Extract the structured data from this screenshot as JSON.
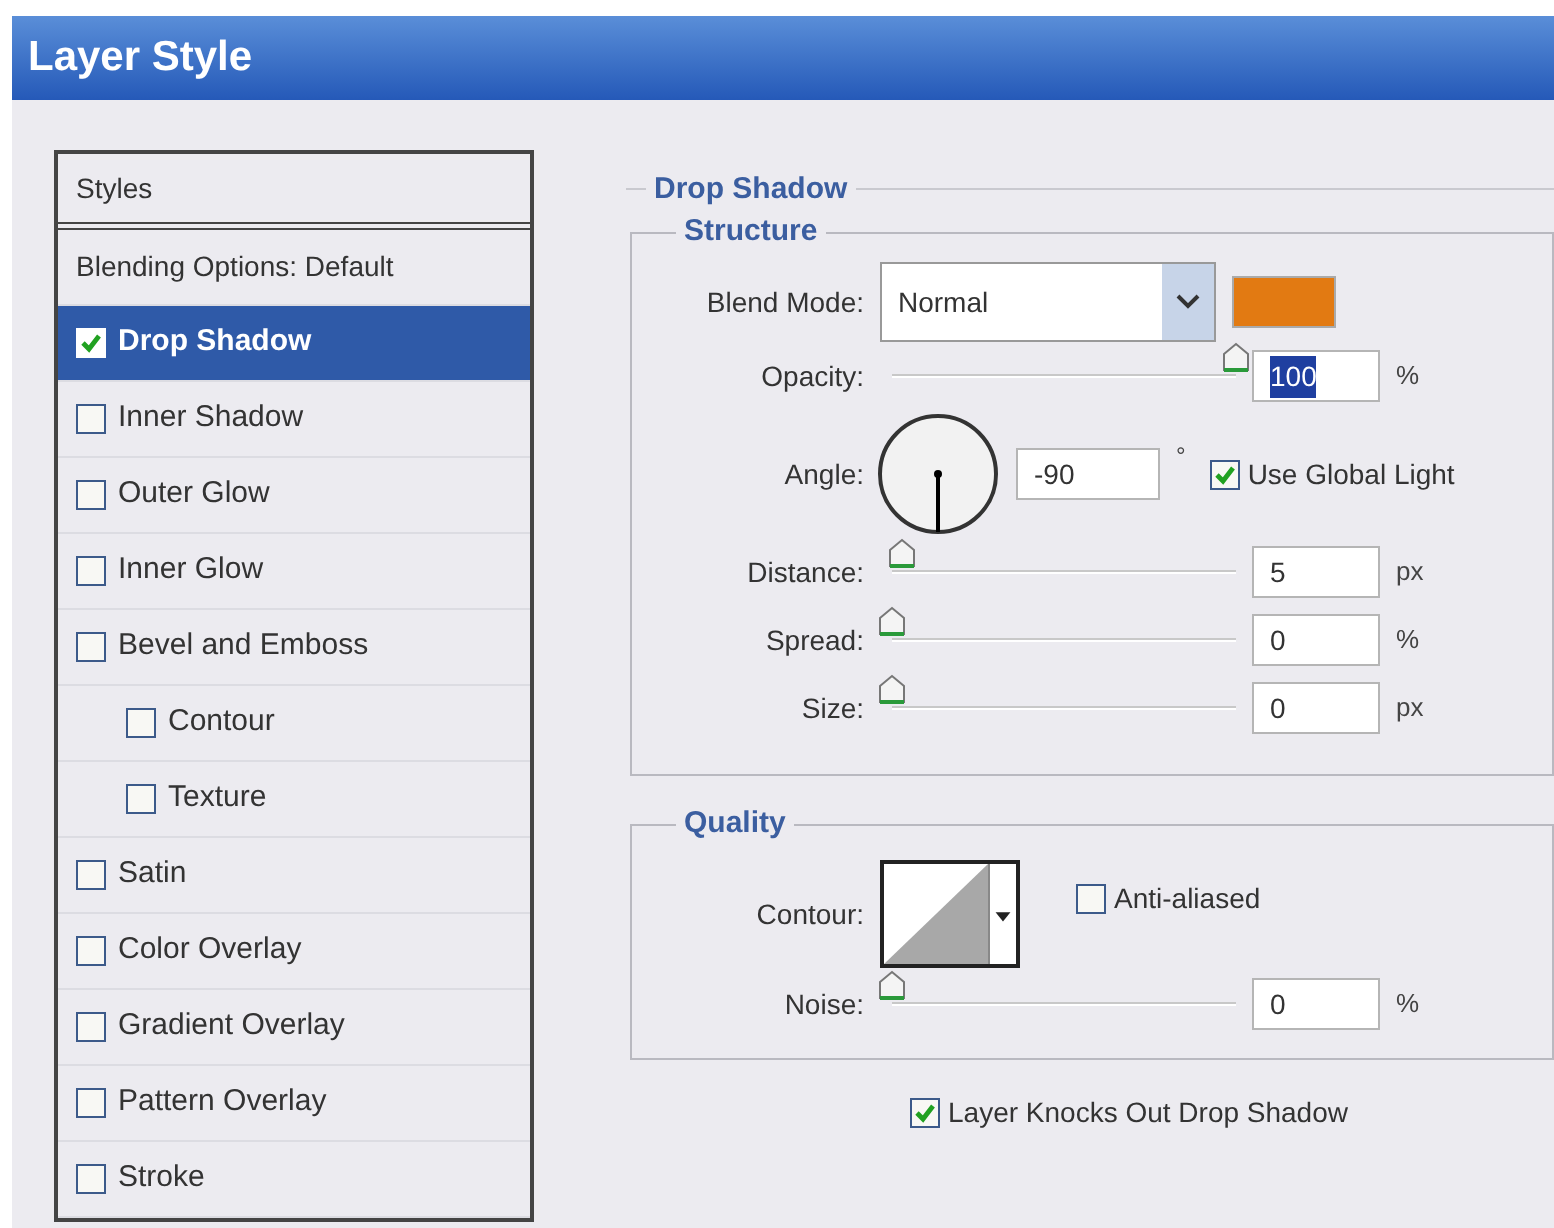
{
  "window": {
    "title": "Layer Style"
  },
  "styles_panel": {
    "header": "Styles",
    "blending_options": "Blending Options: Default",
    "items": [
      {
        "label": "Drop Shadow",
        "checked": true,
        "selected": true
      },
      {
        "label": "Inner Shadow",
        "checked": false,
        "selected": false
      },
      {
        "label": "Outer Glow",
        "checked": false,
        "selected": false
      },
      {
        "label": "Inner Glow",
        "checked": false,
        "selected": false
      },
      {
        "label": "Bevel and Emboss",
        "checked": false,
        "selected": false,
        "children": [
          {
            "label": "Contour",
            "checked": false,
            "selected": false
          },
          {
            "label": "Texture",
            "checked": false,
            "selected": false
          }
        ]
      },
      {
        "label": "Satin",
        "checked": false,
        "selected": false
      },
      {
        "label": "Color Overlay",
        "checked": false,
        "selected": false
      },
      {
        "label": "Gradient Overlay",
        "checked": false,
        "selected": false
      },
      {
        "label": "Pattern Overlay",
        "checked": false,
        "selected": false
      },
      {
        "label": "Stroke",
        "checked": false,
        "selected": false
      }
    ]
  },
  "drop_shadow": {
    "title": "Drop Shadow",
    "structure": {
      "title": "Structure",
      "blend_mode": {
        "label": "Blend Mode:",
        "value": "Normal",
        "color": "#e27a12"
      },
      "opacity": {
        "label": "Opacity:",
        "level": 1,
        "value": "100",
        "unit": "%",
        "text_selected": true
      },
      "angle": {
        "label": "Angle:",
        "value": "-90",
        "unit": "°",
        "use_global_light": {
          "label": "Use Global Light",
          "checked": true
        }
      },
      "sliders": [
        {
          "label": "Distance:",
          "level": 0.03,
          "value": "5",
          "unit": "px",
          "text_selected": false
        },
        {
          "label": "Spread:",
          "level": 0,
          "value": "0",
          "unit": "%",
          "text_selected": false
        },
        {
          "label": "Size:",
          "level": 0,
          "value": "0",
          "unit": "px",
          "text_selected": false
        }
      ]
    },
    "quality": {
      "title": "Quality",
      "contour": {
        "label": "Contour:"
      },
      "anti_aliased": {
        "label": "Anti-aliased",
        "checked": false
      },
      "noise": {
        "label": "Noise:",
        "level": 0,
        "value": "0",
        "unit": "%",
        "text_selected": false
      }
    },
    "knockout": {
      "label": "Layer Knocks Out Drop Shadow",
      "checked": true
    }
  }
}
